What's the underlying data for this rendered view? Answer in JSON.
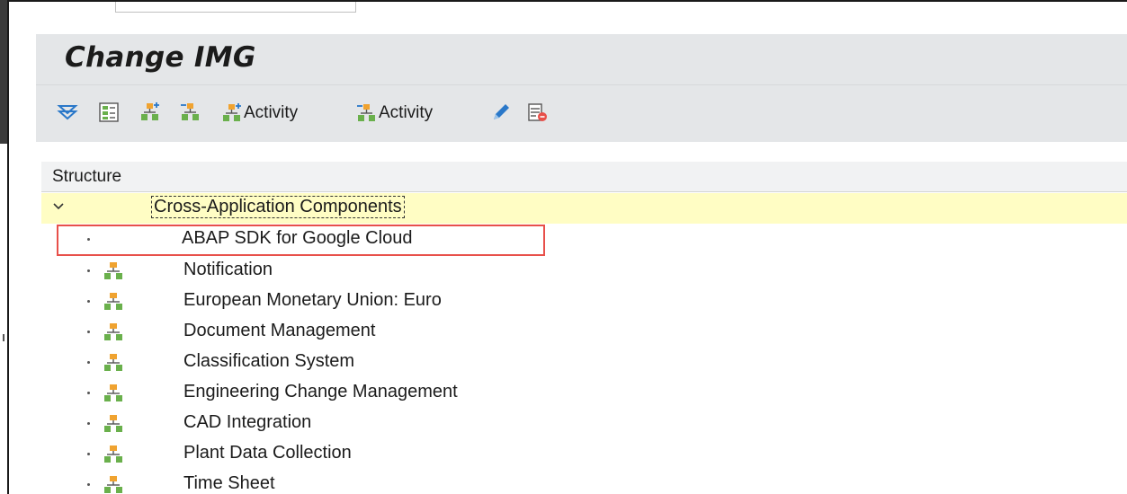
{
  "window": {
    "title": "Change IMG"
  },
  "toolbar": {
    "icons": [
      "expand-all-icon",
      "select-subtree-icon",
      "add-node-icon",
      "remove-node-icon",
      "edit-icon",
      "delete-icon"
    ],
    "activity_create_label": "Activity",
    "activity_change_label": "Activity"
  },
  "structure": {
    "header": "Structure",
    "root": {
      "label": "Cross-Application Components",
      "expanded": true
    },
    "items": [
      {
        "label": "ABAP SDK for Google Cloud",
        "has_icon": false
      },
      {
        "label": "Notification",
        "has_icon": true
      },
      {
        "label": "European Monetary Union: Euro",
        "has_icon": true
      },
      {
        "label": "Document Management",
        "has_icon": true
      },
      {
        "label": "Classification System",
        "has_icon": true
      },
      {
        "label": "Engineering Change Management",
        "has_icon": true
      },
      {
        "label": "CAD Integration",
        "has_icon": true
      },
      {
        "label": "Plant Data Collection",
        "has_icon": true
      },
      {
        "label": "Time Sheet",
        "has_icon": true
      }
    ]
  },
  "colors": {
    "toolbar_bg": "#e4e6e8",
    "selection_bg": "#fffdc4",
    "highlight_border": "#e8504a",
    "node_icon_orange": "#f0a330",
    "node_icon_green": "#6ab04c"
  }
}
